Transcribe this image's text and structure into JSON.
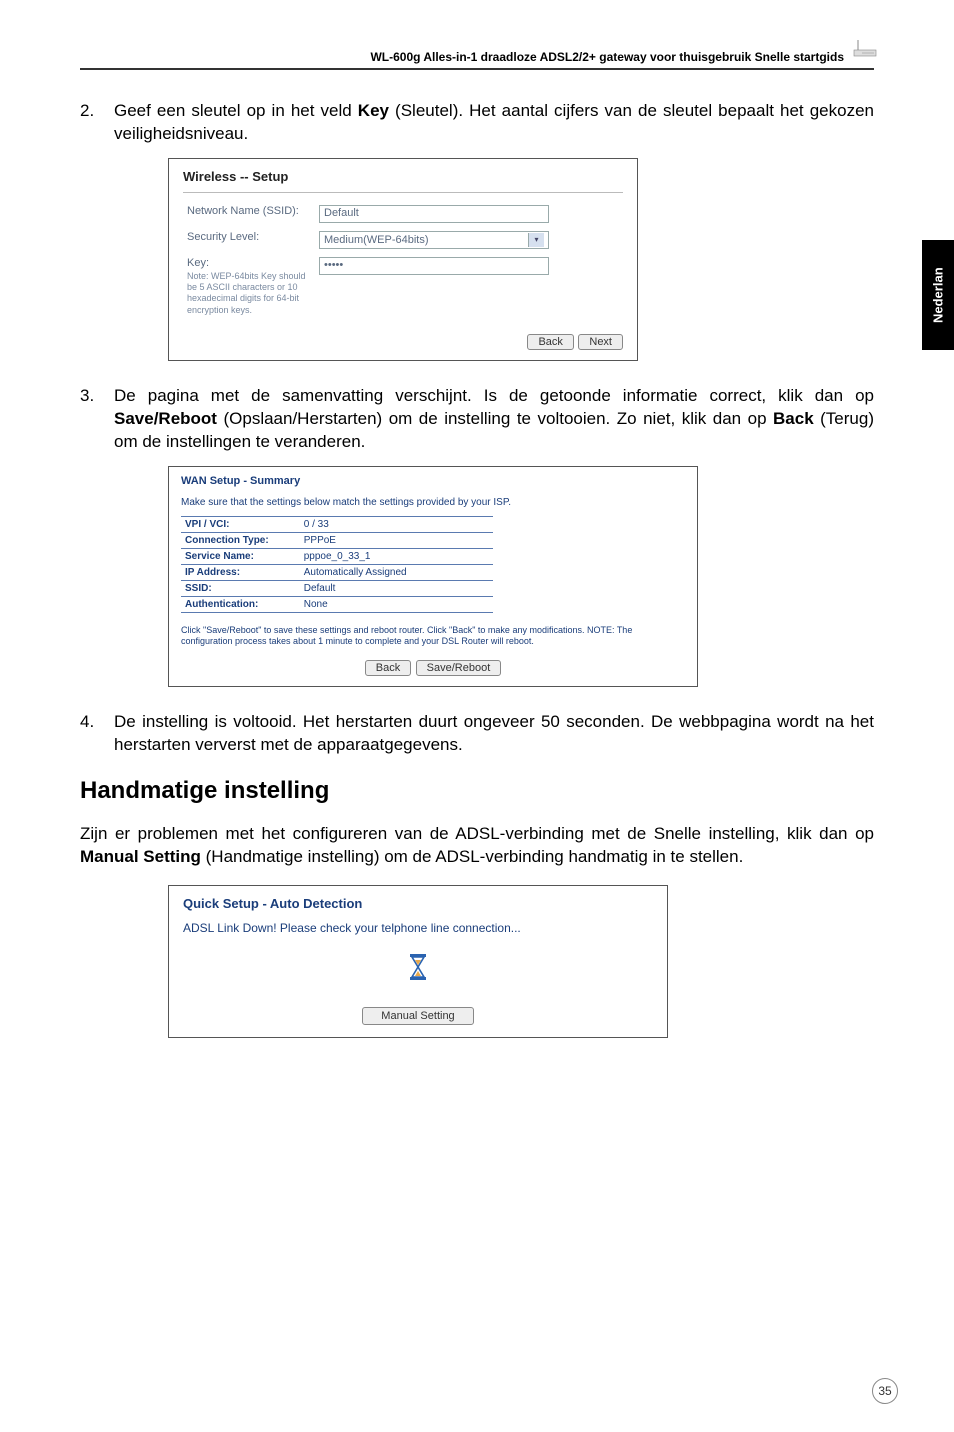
{
  "header": {
    "title": "WL-600g Alles-in-1 draadloze ADSL2/2+ gateway voor thuisgebruik Snelle startgids"
  },
  "side_tab": "Nederlan",
  "page_number": "35",
  "steps": {
    "s2": {
      "num": "2.",
      "text_a": "Geef een sleutel op in het veld ",
      "bold": "Key",
      "text_b": " (Sleutel). Het aantal cijfers van de sleutel bepaalt het gekozen veiligheidsniveau."
    },
    "s3": {
      "num": "3.",
      "text_a": "De pagina met de samenvatting verschijnt. Is de getoonde informatie correct, klik dan op ",
      "bold1": "Save/Reboot",
      "text_b": " (Opslaan/Herstarten) om de instelling te voltooien. Zo niet, klik dan op ",
      "bold2": "Back",
      "text_c": " (Terug) om de instellingen te veranderen."
    },
    "s4": {
      "num": "4.",
      "text": "De instelling is voltooid. Het herstarten duurt ongeveer 50 seconden. De webbpagina wordt na het herstarten ververst met de apparaatgegevens."
    }
  },
  "heading_manual": "Handmatige instelling",
  "para_manual": {
    "a": "Zijn er problemen met het configureren van de ADSL-verbinding met de Snelle instelling, klik dan op ",
    "bold": "Manual Setting",
    "b": " (Handmatige instelling) om de ADSL-verbinding handmatig in te stellen."
  },
  "fig1": {
    "title": "Wireless -- Setup",
    "rows": {
      "ssid_label": "Network Name (SSID):",
      "ssid_value": "Default",
      "sec_label": "Security Level:",
      "sec_value": "Medium(WEP-64bits)",
      "key_label": "Key:",
      "key_value": "•••••",
      "key_note": "Note: WEP-64bits Key should be 5 ASCII characters or 10 hexadecimal digits for 64-bit encryption keys."
    },
    "btn_back": "Back",
    "btn_next": "Next"
  },
  "fig2": {
    "title": "WAN Setup - Summary",
    "subtitle": "Make sure that the settings below match the settings provided by your ISP.",
    "rows": [
      {
        "k": "VPI / VCI:",
        "v": "0 / 33"
      },
      {
        "k": "Connection Type:",
        "v": "PPPoE"
      },
      {
        "k": "Service Name:",
        "v": "pppoe_0_33_1"
      },
      {
        "k": "IP Address:",
        "v": "Automatically Assigned"
      },
      {
        "k": "SSID:",
        "v": "Default"
      },
      {
        "k": "Authentication:",
        "v": "None"
      }
    ],
    "note": "Click \"Save/Reboot\" to save these settings and reboot router. Click \"Back\" to make any modifications. NOTE: The configuration process takes about 1 minute to complete and your DSL Router will reboot.",
    "btn_back": "Back",
    "btn_save": "Save/Reboot"
  },
  "fig3": {
    "title": "Quick Setup - Auto Detection",
    "msg": "ADSL Link Down! Please check your telphone line connection...",
    "btn": "Manual Setting"
  }
}
